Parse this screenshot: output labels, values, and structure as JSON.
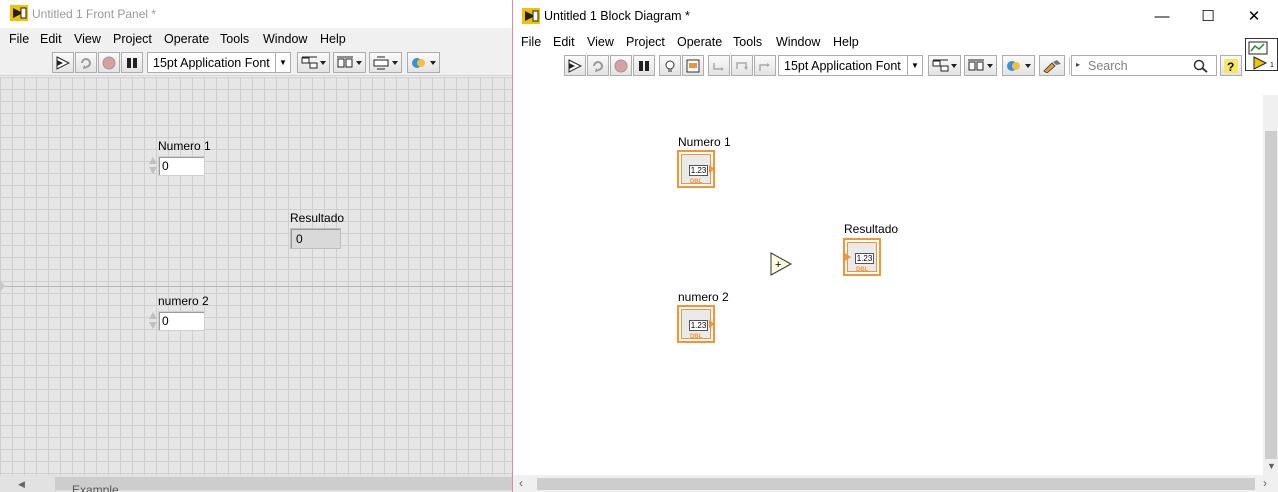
{
  "front_panel": {
    "title": "Untitled 1 Front Panel *",
    "menu": [
      "File",
      "Edit",
      "View",
      "Project",
      "Operate",
      "Tools",
      "Window",
      "Help"
    ],
    "font": "15pt Application Font",
    "controls": {
      "numero1": {
        "label": "Numero 1",
        "value": "0"
      },
      "numero2": {
        "label": "numero  2",
        "value": "0"
      },
      "resultado": {
        "label": "Resultado",
        "value": "0"
      }
    },
    "partial_label": "Example"
  },
  "block_diagram": {
    "title": "Untitled 1 Block Diagram *",
    "menu": [
      "File",
      "Edit",
      "View",
      "Project",
      "Operate",
      "Tools",
      "Window",
      "Help"
    ],
    "font": "15pt Application Font",
    "search_placeholder": "Search",
    "window_controls": {
      "minimize": "—",
      "maximize": "☐",
      "close": "✕"
    },
    "terminals": {
      "numero1": {
        "label": "Numero 1",
        "display": "1.23",
        "type": "DBL"
      },
      "numero2": {
        "label": "numero  2",
        "display": "1.23",
        "type": "DBL"
      },
      "resultado": {
        "label": "Resultado",
        "display": "1.23",
        "type": "DBL"
      }
    },
    "add_node": "+"
  },
  "colors": {
    "terminal_orange": "#f0953a",
    "window_border": "#cf8fa2"
  },
  "icons": [
    "labview-icon",
    "run-arrow-icon",
    "run-continuously-icon",
    "abort-icon",
    "pause-icon",
    "highlight-execution-icon",
    "step-into-icon",
    "step-over-icon",
    "step-out-icon",
    "align-icon",
    "distribute-icon",
    "resize-icon",
    "reorder-icon",
    "cleanup-icon",
    "search-icon",
    "help-icon"
  ]
}
